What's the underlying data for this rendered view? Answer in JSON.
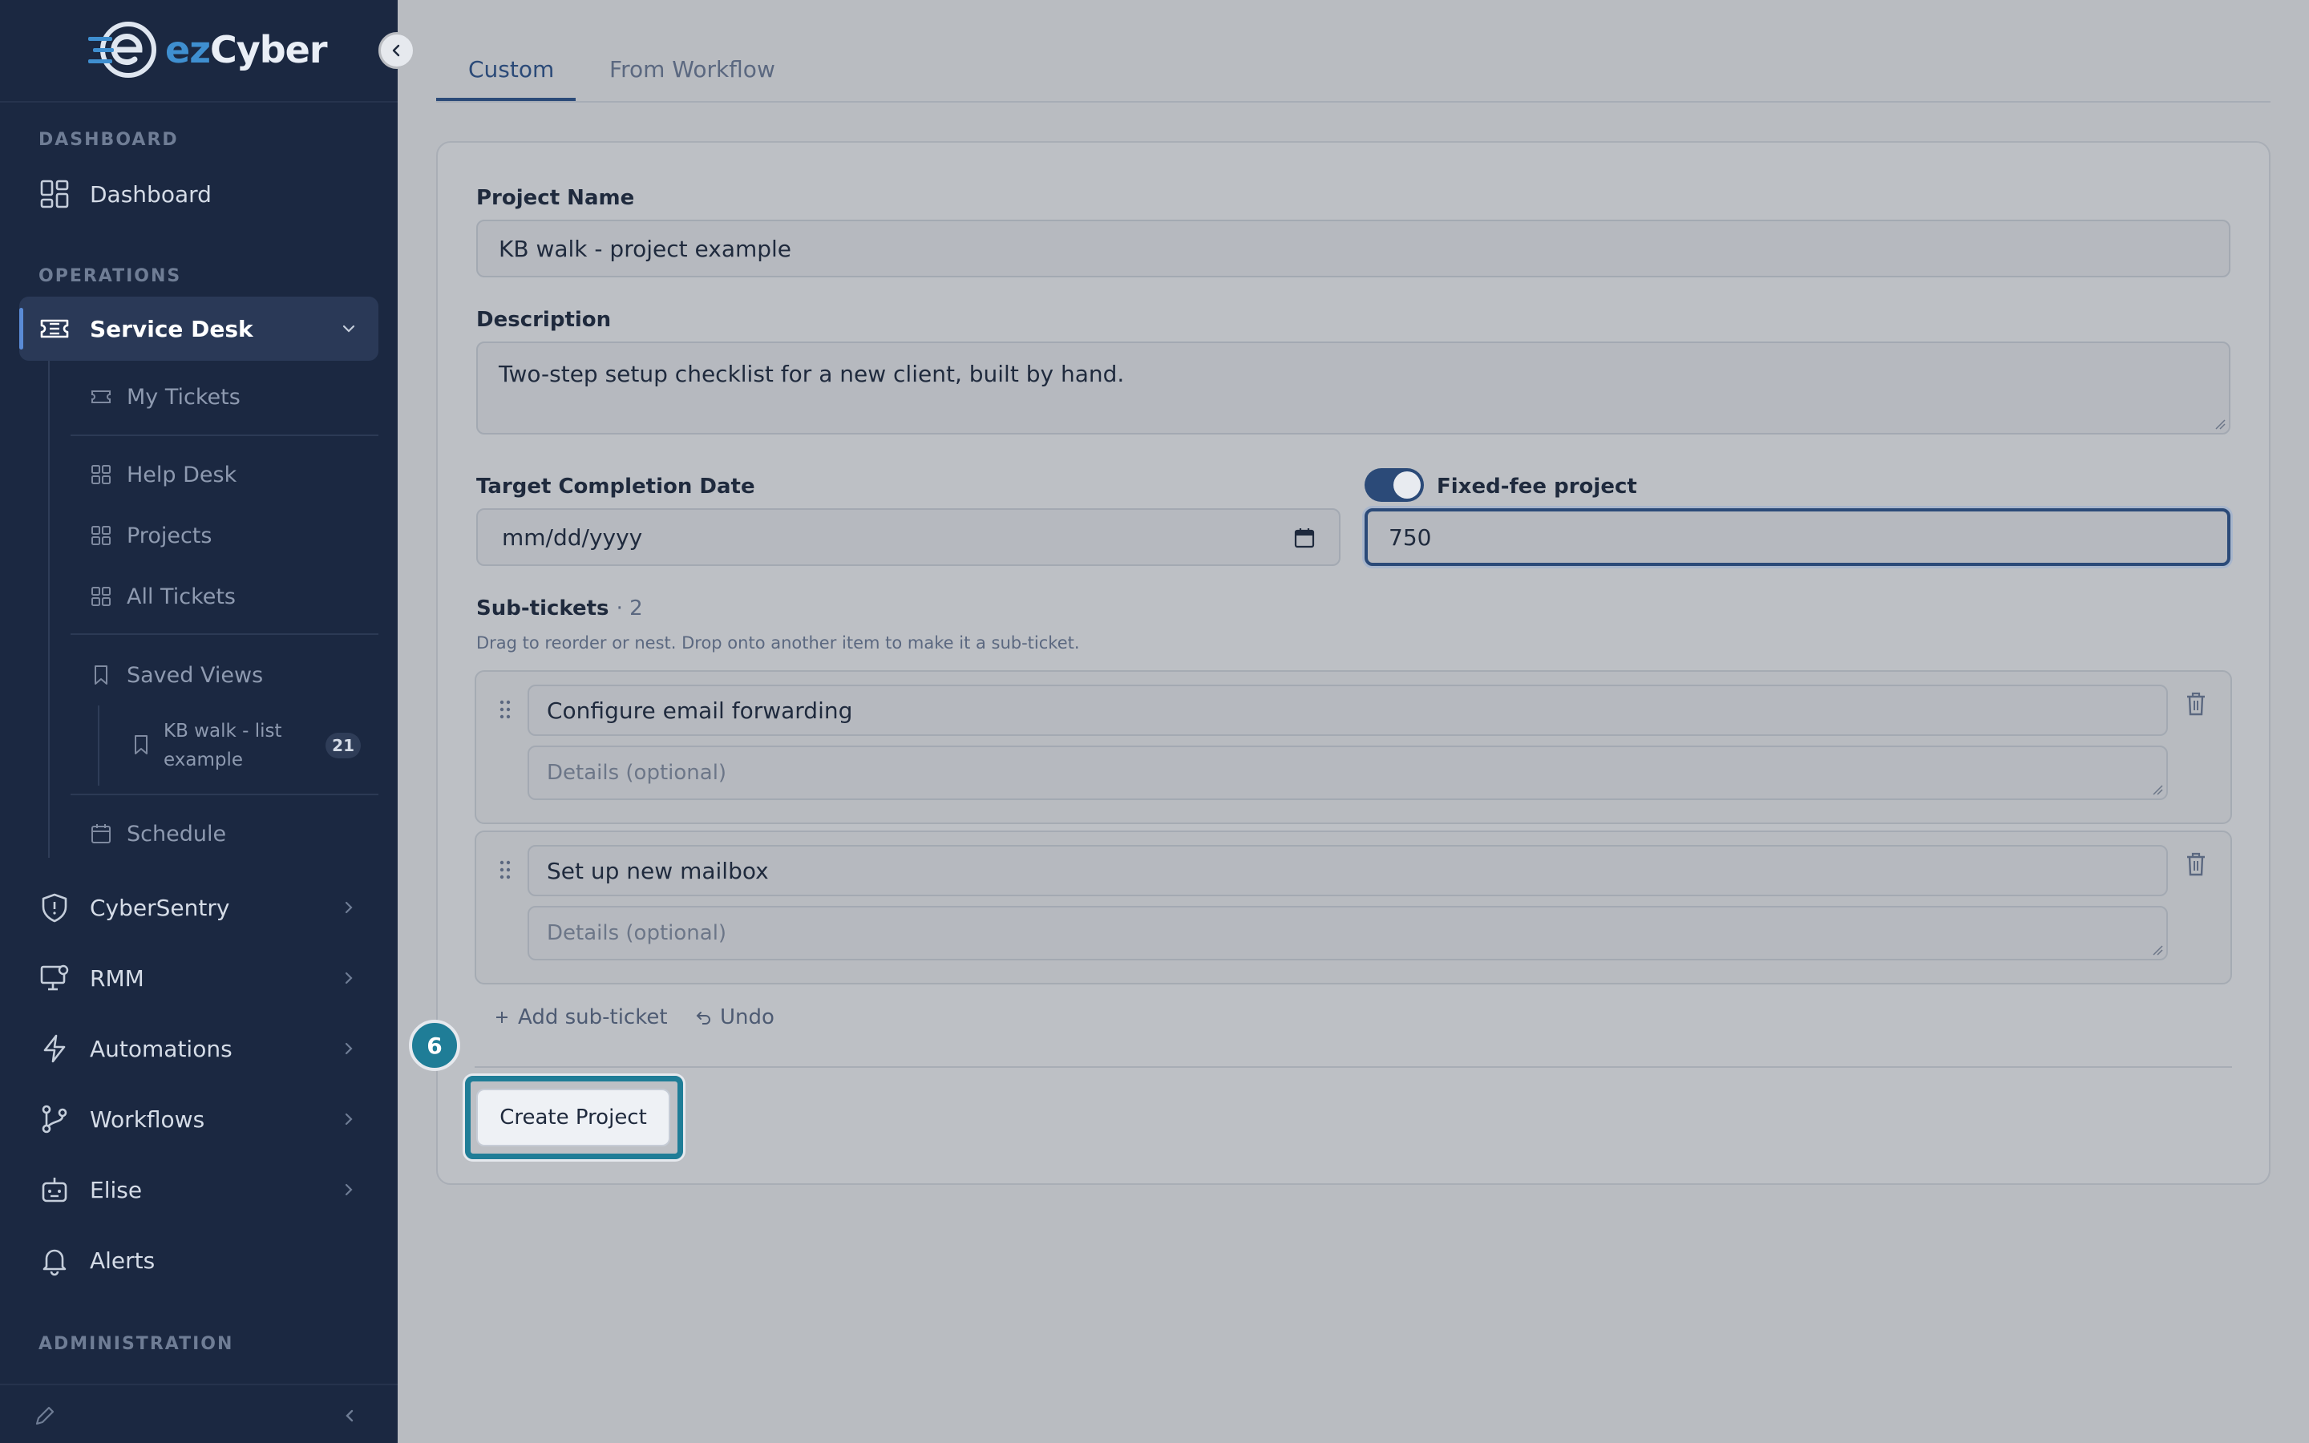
{
  "brand": {
    "name_prefix": "ez",
    "name_suffix": "Cyber"
  },
  "sidebar": {
    "sections": {
      "dashboard": "DASHBOARD",
      "operations": "OPERATIONS",
      "administration": "ADMINISTRATION"
    },
    "dashboard_label": "Dashboard",
    "service_desk_label": "Service Desk",
    "sub_items": {
      "my_tickets": "My Tickets",
      "help_desk": "Help Desk",
      "projects": "Projects",
      "all_tickets": "All Tickets",
      "saved_views": "Saved Views",
      "schedule": "Schedule"
    },
    "saved_view": {
      "label": "KB walk - list example",
      "count": "21"
    },
    "items": {
      "cybersentry": "CyberSentry",
      "rmm": "RMM",
      "automations": "Automations",
      "workflows": "Workflows",
      "elise": "Elise",
      "alerts": "Alerts"
    }
  },
  "tabs": {
    "custom": "Custom",
    "from_workflow": "From Workflow",
    "active": "Custom"
  },
  "form": {
    "project_name_label": "Project Name",
    "project_name_value": "KB walk - project example",
    "description_label": "Description",
    "description_value": "Two-step setup checklist for a new client, built by hand.",
    "target_date_label": "Target Completion Date",
    "target_date_placeholder": "mm/dd/yyyy",
    "fixed_fee_label": "Fixed-fee project",
    "fixed_fee_enabled": true,
    "fixed_fee_value": "750",
    "subtickets_label": "Sub-tickets",
    "subtickets_count": "· 2",
    "subtickets_hint": "Drag to reorder or nest. Drop onto another item to make it a sub-ticket.",
    "subtickets": [
      {
        "title": "Configure email forwarding",
        "details_placeholder": "Details (optional)"
      },
      {
        "title": "Set up new mailbox",
        "details_placeholder": "Details (optional)"
      }
    ],
    "add_subticket_label": "Add sub-ticket",
    "undo_label": "Undo",
    "create_button_label": "Create Project"
  },
  "tutorial": {
    "step_number": "6"
  },
  "colors": {
    "sidebar_bg": "#1b2841",
    "accent": "#2b4a78",
    "highlight": "#1f7d97"
  }
}
